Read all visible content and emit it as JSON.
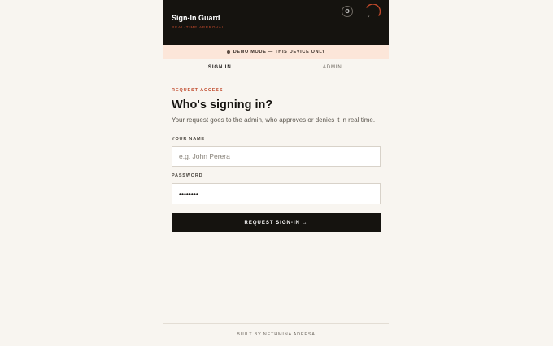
{
  "header": {
    "title": "Sign-In Guard",
    "subtitle": "REAL-TIME APPROVAL",
    "settings_icon": "gear-icon",
    "status_icon": "spinner-icon",
    "accent_color": "#c0492b"
  },
  "banner": {
    "text": "DEMO MODE — THIS DEVICE ONLY"
  },
  "tabs": [
    {
      "label": "SIGN IN",
      "active": true
    },
    {
      "label": "ADMIN",
      "active": false
    }
  ],
  "form": {
    "eyebrow": "REQUEST ACCESS",
    "heading": "Who's signing in?",
    "description": "Your request goes to the admin, who approves or denies it in real time.",
    "name_label": "YOUR NAME",
    "name_placeholder": "e.g. John Perera",
    "name_value": "",
    "password_label": "PASSWORD",
    "password_value": "••••••••",
    "submit_label": "REQUEST SIGN-IN →"
  },
  "footer": {
    "text": "BUILT BY NETHMINA ADEESA"
  }
}
